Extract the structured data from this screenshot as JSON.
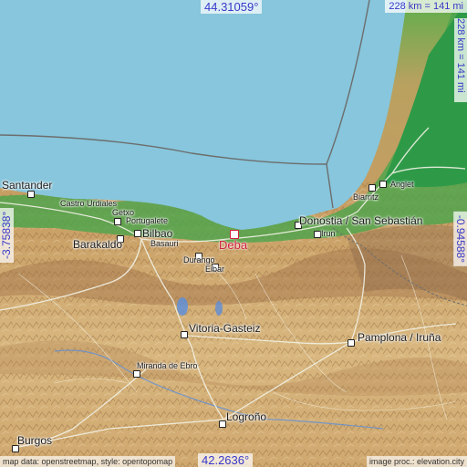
{
  "coordinates": {
    "north": "44.31059°",
    "south": "42.2636°",
    "west": "-3.75838°",
    "east": "-0.94588°"
  },
  "scale": {
    "horizontal": "228 km = 141 mi",
    "vertical": "228 km = 141 mi"
  },
  "attribution": {
    "left": "map data: openstreetmap, style: opentopomap",
    "right": "image proc.: elevation.city"
  },
  "highlight": {
    "name": "Deba",
    "color": "#d0203c"
  },
  "places": [
    {
      "name": "Santander",
      "size": "lg"
    },
    {
      "name": "Castro Urdiales",
      "size": "sm"
    },
    {
      "name": "Getxo",
      "size": "sm"
    },
    {
      "name": "Portugalete",
      "size": "sm"
    },
    {
      "name": "Barakaldo",
      "size": "lg"
    },
    {
      "name": "Bilbao",
      "size": "lg"
    },
    {
      "name": "Basauri",
      "size": "sm"
    },
    {
      "name": "Durango",
      "size": "sm"
    },
    {
      "name": "Eibar",
      "size": "sm"
    },
    {
      "name": "Donostia / San Sebastián",
      "size": "lg"
    },
    {
      "name": "Irun",
      "size": "sm"
    },
    {
      "name": "Anglet",
      "size": "sm"
    },
    {
      "name": "Biarritz",
      "size": "sm"
    },
    {
      "name": "Vitoria-Gasteiz",
      "size": "lg"
    },
    {
      "name": "Pamplona / Iruña",
      "size": "lg"
    },
    {
      "name": "Miranda de Ebro",
      "size": "sm"
    },
    {
      "name": "Logroño",
      "size": "lg"
    },
    {
      "name": "Burgos",
      "size": "lg"
    }
  ],
  "colors": {
    "sea": "#87c6dc",
    "lowland_green": "#3aa84a",
    "hills_tan": "#d2b27a",
    "mountain_brown": "#a7784a",
    "roads": "#f2f2e6",
    "text_accent": "#3838c8"
  }
}
